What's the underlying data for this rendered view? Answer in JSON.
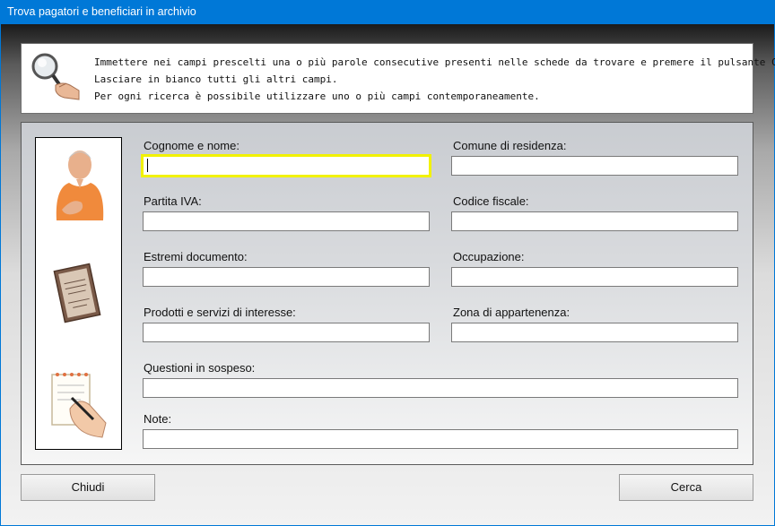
{
  "window": {
    "title": "Trova pagatori e beneficiari in archivio"
  },
  "info": {
    "icon": "magnifier-hand-icon",
    "lines": [
      "Immettere nei campi prescelti una o più parole consecutive presenti nelle schede da trovare e premere il pulsante Cerca.",
      "Lasciare in bianco tutti gli altri campi.",
      "Per ogni ricerca è possibile utilizzare uno o più campi contemporaneamente."
    ]
  },
  "images": [
    "person-photo",
    "document-booklet",
    "hand-writing-notepad"
  ],
  "fields": {
    "cognome_nome": {
      "label": "Cognome e nome:",
      "value": ""
    },
    "comune_residenza": {
      "label": "Comune di residenza:",
      "value": ""
    },
    "partita_iva": {
      "label": "Partita IVA:",
      "value": ""
    },
    "codice_fiscale": {
      "label": "Codice fiscale:",
      "value": ""
    },
    "estremi_documento": {
      "label": "Estremi documento:",
      "value": ""
    },
    "occupazione": {
      "label": "Occupazione:",
      "value": ""
    },
    "prodotti_servizi": {
      "label": "Prodotti e servizi di interesse:",
      "value": ""
    },
    "zona_appartenenza": {
      "label": "Zona di appartenenza:",
      "value": ""
    },
    "questioni_sospeso": {
      "label": "Questioni in sospeso:",
      "value": ""
    },
    "note": {
      "label": "Note:",
      "value": ""
    }
  },
  "buttons": {
    "chiudi": "Chiudi",
    "cerca": "Cerca"
  },
  "colors": {
    "titlebar": "#0078d7",
    "focus_border": "#f2f200"
  }
}
